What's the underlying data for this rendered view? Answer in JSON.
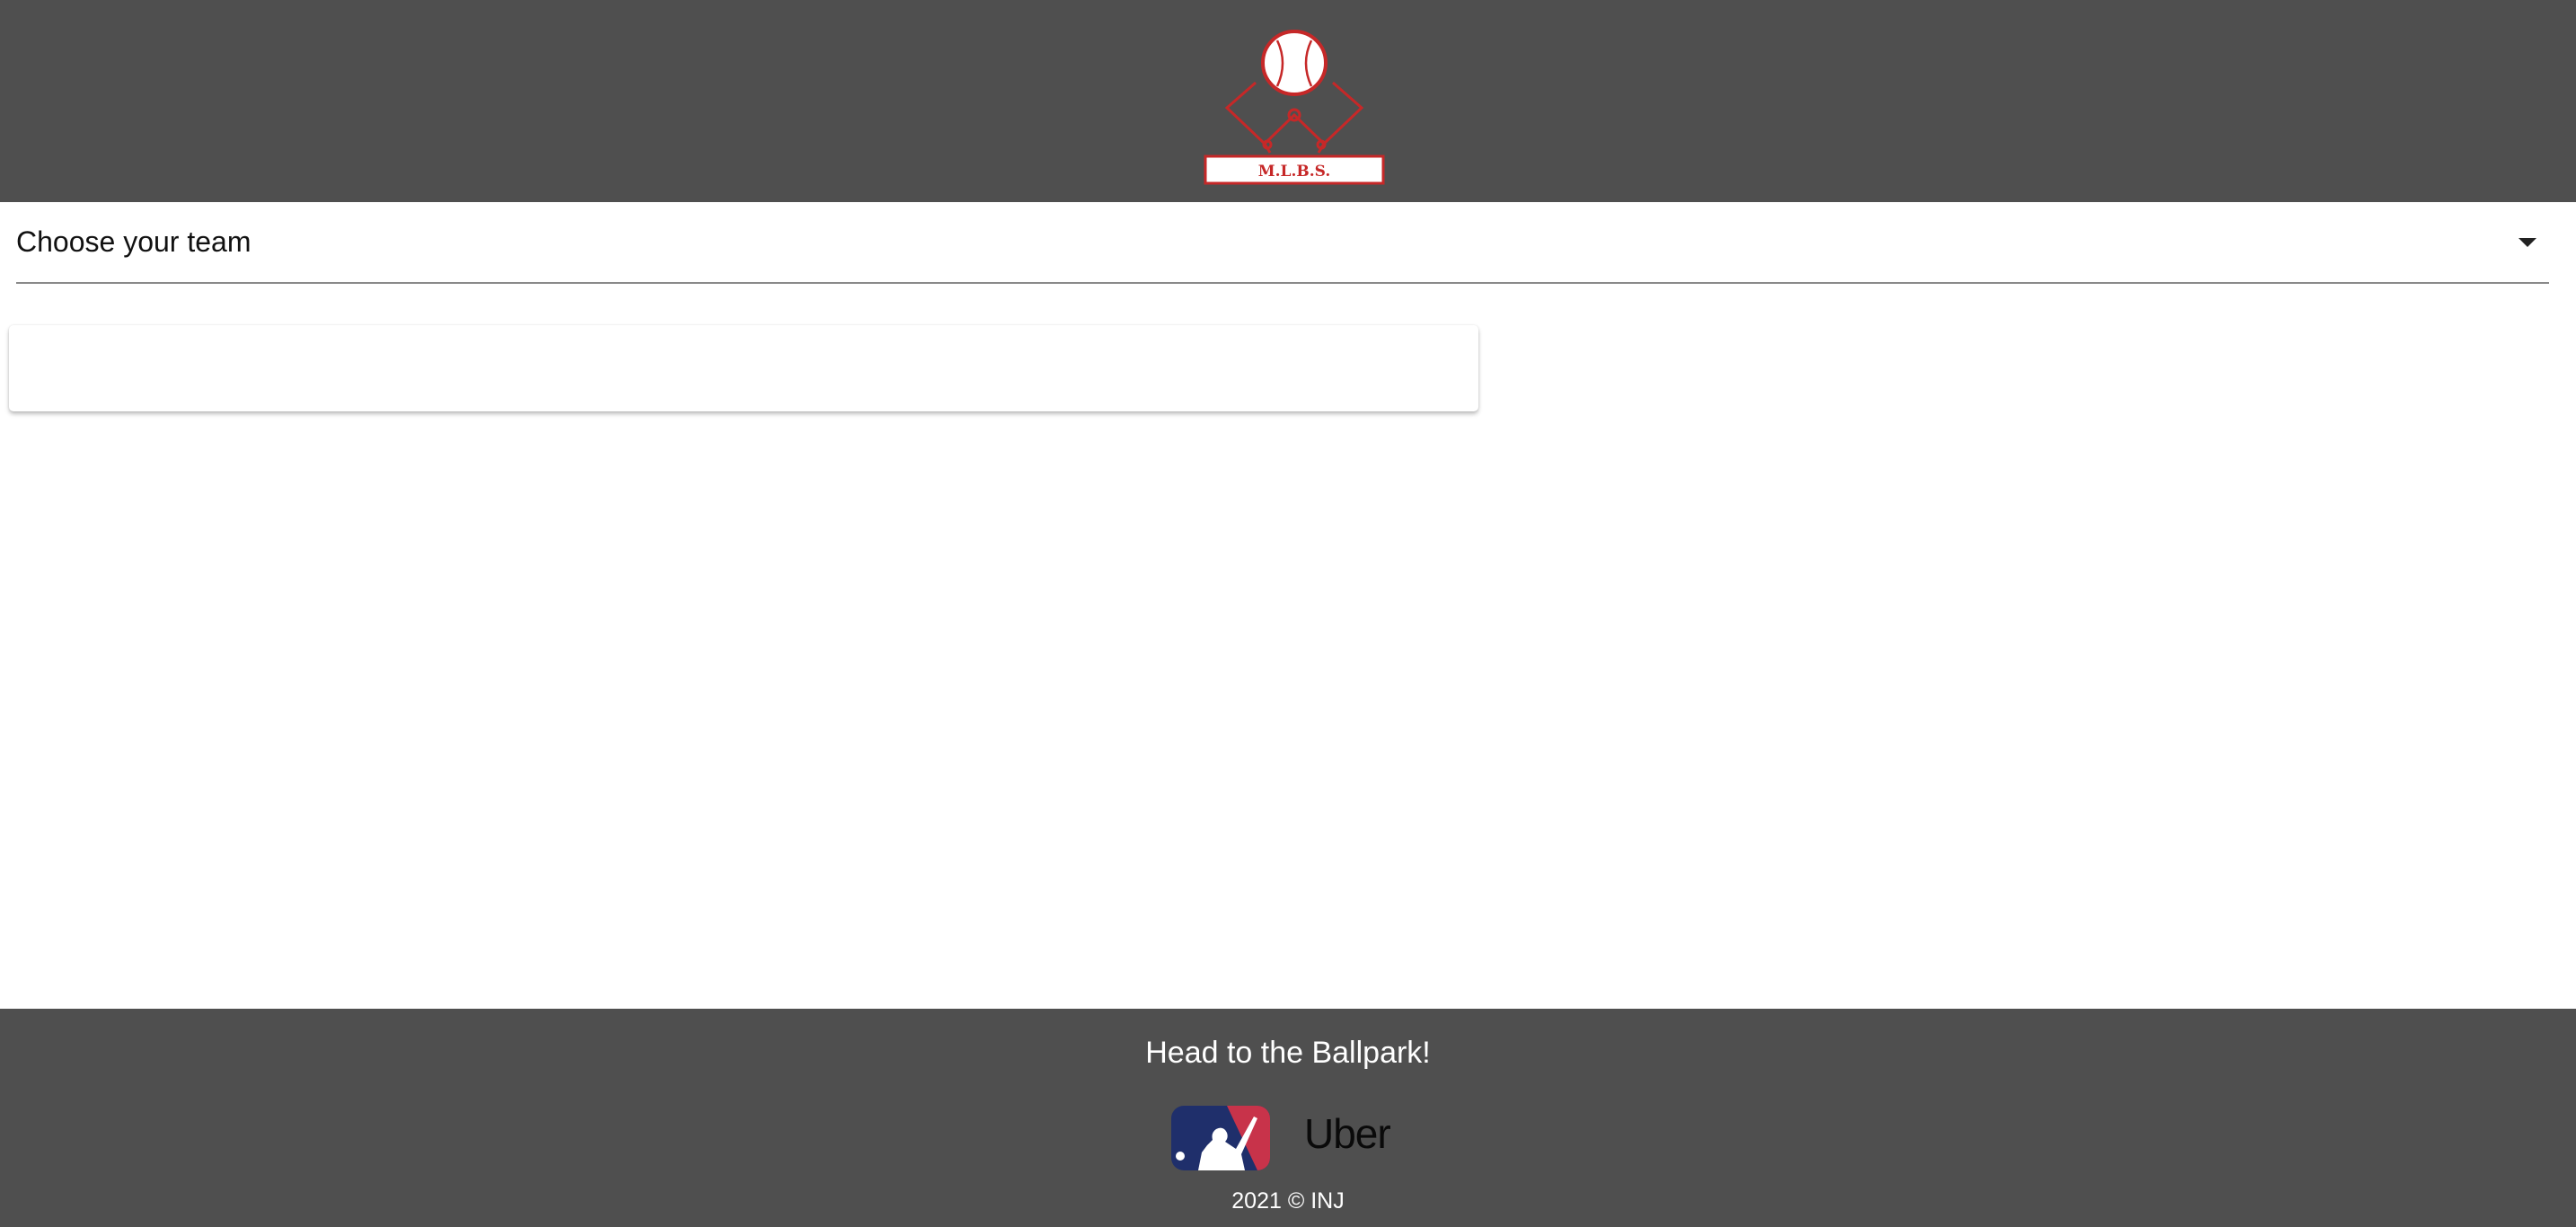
{
  "header": {
    "logo_text": "M.L.B.S.",
    "logo_icon": "baseball-diamond-logo",
    "background_color": "#4f4f4f",
    "logo_color": "#c62828"
  },
  "team_select": {
    "label": "Choose your team",
    "icon": "caret-down-icon"
  },
  "footer": {
    "title": "Head to the Ballpark!",
    "partner_logos": [
      "mlb-logo",
      "uber-logo"
    ],
    "uber_text": "Uber",
    "copyright": "2021 © INJ",
    "background_color": "#4f4f4f"
  }
}
